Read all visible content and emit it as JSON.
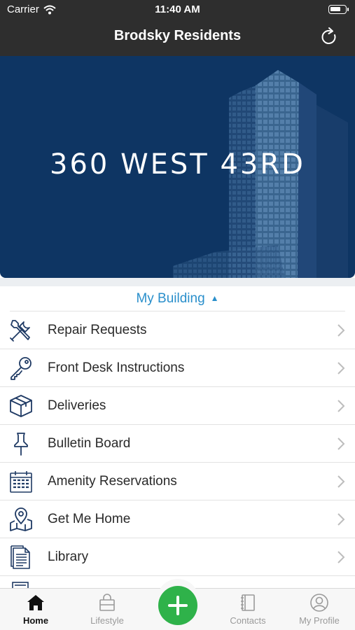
{
  "status_bar": {
    "carrier": "Carrier",
    "time": "11:40 AM"
  },
  "nav": {
    "title": "Brodsky Residents",
    "refresh_icon": "refresh-icon"
  },
  "hero": {
    "building_name": "360 WEST 43RD"
  },
  "section": {
    "title": "My Building",
    "toggle_glyph": "▲"
  },
  "menu_items": [
    {
      "label": "Repair Requests",
      "icon": "tools-icon"
    },
    {
      "label": "Front Desk Instructions",
      "icon": "key-icon"
    },
    {
      "label": "Deliveries",
      "icon": "package-icon"
    },
    {
      "label": "Bulletin Board",
      "icon": "pushpin-icon"
    },
    {
      "label": "Amenity Reservations",
      "icon": "calendar-icon"
    },
    {
      "label": "Get Me Home",
      "icon": "map-pin-icon"
    },
    {
      "label": "Library",
      "icon": "document-icon"
    }
  ],
  "tabs": [
    {
      "label": "Home",
      "icon": "home-icon",
      "active": true
    },
    {
      "label": "Lifestyle",
      "icon": "shopping-bag-icon",
      "active": false
    },
    {
      "label": "Contacts",
      "icon": "address-book-icon",
      "active": false
    },
    {
      "label": "My Profile",
      "icon": "person-icon",
      "active": false
    }
  ],
  "colors": {
    "nav_bg": "#2e2e2e",
    "hero_bg": "#0e3563",
    "accent_blue": "#2a8fcb",
    "fab_green": "#2fb24a",
    "icon_navy": "#1f3a64"
  }
}
